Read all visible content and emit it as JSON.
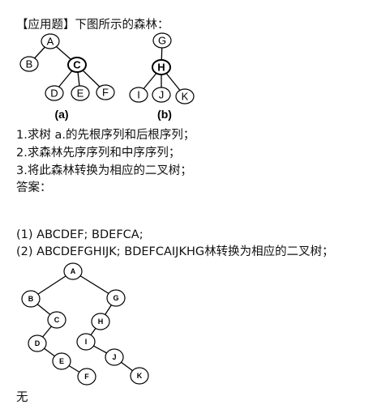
{
  "question": {
    "title": "【应用题】下图所示的森林：",
    "items": [
      "1.求树 a.的先根序列和后根序列；",
      "2.求森林先序序列和中序序列；",
      "3.将此森林转换为相应的二叉树；"
    ],
    "answer_label": "答案："
  },
  "figure1": {
    "tree_a": {
      "nodes": [
        "A",
        "B",
        "C",
        "D",
        "E",
        "F"
      ],
      "caption": "(a)"
    },
    "tree_b": {
      "nodes": [
        "G",
        "H",
        "I",
        "J",
        "K"
      ],
      "caption": "(b)"
    }
  },
  "answer": {
    "line1": "(1) ABCDEF; BDEFCA;",
    "line2": "(2) ABCDEFGHIJK; BDEFCAIJKHG林转换为相应的二叉树；"
  },
  "figure2": {
    "nodes": [
      "A",
      "B",
      "C",
      "D",
      "E",
      "F",
      "G",
      "H",
      "I",
      "J",
      "K"
    ]
  },
  "footer": "无"
}
